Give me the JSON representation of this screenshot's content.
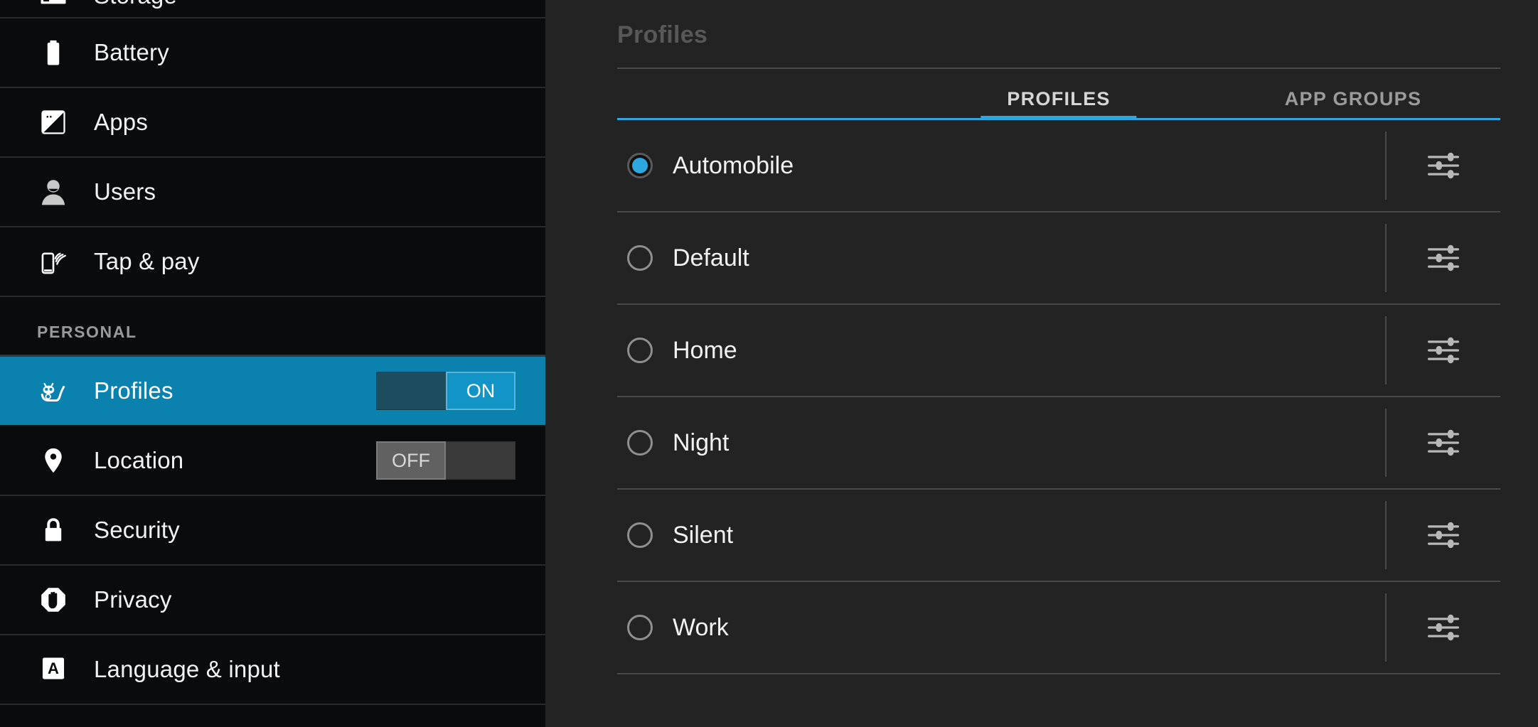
{
  "sidebar": {
    "items": [
      {
        "label": "Storage",
        "icon": "storage-icon",
        "clipped": true,
        "selected": false,
        "toggle": null
      },
      {
        "label": "Battery",
        "icon": "battery-icon",
        "clipped": false,
        "selected": false,
        "toggle": null
      },
      {
        "label": "Apps",
        "icon": "apps-icon",
        "clipped": false,
        "selected": false,
        "toggle": null
      },
      {
        "label": "Users",
        "icon": "users-icon",
        "clipped": false,
        "selected": false,
        "toggle": null
      },
      {
        "label": "Tap & pay",
        "icon": "tap-and-pay-icon",
        "clipped": false,
        "selected": false,
        "toggle": null
      }
    ],
    "section_label": "PERSONAL",
    "personal_items": [
      {
        "label": "Profiles",
        "icon": "cyanogenmod-cid-icon",
        "selected": true,
        "toggle": "ON"
      },
      {
        "label": "Location",
        "icon": "location-pin-icon",
        "selected": false,
        "toggle": "OFF"
      },
      {
        "label": "Security",
        "icon": "lock-icon",
        "selected": false,
        "toggle": null
      },
      {
        "label": "Privacy",
        "icon": "privacy-hand-icon",
        "selected": false,
        "toggle": null
      },
      {
        "label": "Language & input",
        "icon": "language-input-icon",
        "selected": false,
        "toggle": null
      }
    ]
  },
  "main": {
    "page_title": "Profiles",
    "tabs": [
      {
        "label": "PROFILES",
        "active": true
      },
      {
        "label": "APP GROUPS",
        "active": false
      }
    ],
    "profiles": [
      {
        "name": "Automobile",
        "selected": true
      },
      {
        "name": "Default",
        "selected": false
      },
      {
        "name": "Home",
        "selected": false
      },
      {
        "name": "Night",
        "selected": false
      },
      {
        "name": "Silent",
        "selected": false
      },
      {
        "name": "Work",
        "selected": false
      }
    ],
    "row_action_icon": "tune-sliders-icon"
  },
  "colors": {
    "accent_blue": "#2da7e0",
    "selected_row_blue": "#0b81ad",
    "sidebar_bg": "#0a0b0d",
    "main_bg": "#232323",
    "divider": "#4a4a4a",
    "text_primary": "#f2f2f2",
    "text_muted": "#9b9b9b",
    "title_muted": "#585858"
  }
}
